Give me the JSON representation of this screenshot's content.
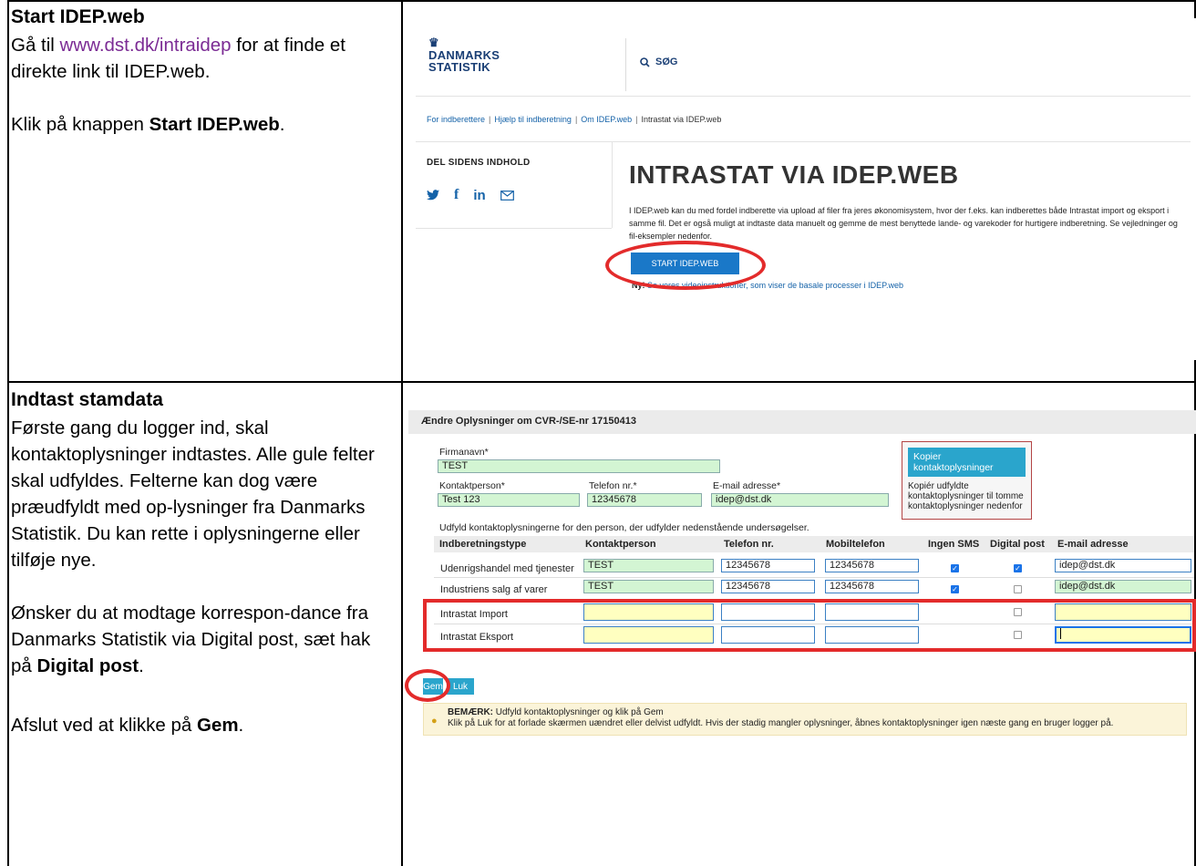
{
  "row1": {
    "heading": "Start IDEP.web",
    "p1_before": "Gå til ",
    "p1_link": "www.dst.dk/intraidep",
    "p1_after": " for at finde et direkte link til IDEP.web.",
    "p2_before": "Klik på knappen ",
    "p2_bold": "Start IDEP.web",
    "p2_after": "."
  },
  "row2": {
    "heading": "Indtast stamdata",
    "p1": "Første gang du logger ind, skal kontaktoplysninger indtastes. Alle gule felter skal udfyldes. Felterne kan dog være præudfyldt med op-lysninger fra Danmarks Statistik. Du kan rette i oplysningerne eller tilføje nye.",
    "p2_before": "Ønsker du at modtage korrespon-dance fra Danmarks Statistik via Digital post, sæt hak på ",
    "p2_bold": "Digital post",
    "p2_after": ".",
    "p3_before": "Afslut ved at klikke på ",
    "p3_bold": "Gem",
    "p3_after": "."
  },
  "site": {
    "logo_line1": "DANMARKS",
    "logo_line2": "STATISTIK",
    "search_label": "SØG",
    "breadcrumb": [
      "For indberettere",
      "Hjælp til indberetning",
      "Om IDEP.web",
      "Intrastat via IDEP.web"
    ],
    "share_title": "DEL SIDENS INDHOLD",
    "page_title": "INTRASTAT VIA IDEP.WEB",
    "intro": "I IDEP.web kan du med fordel indberette via upload af filer fra jeres økonomisystem, hvor der f.eks. kan indberettes både Intrastat import og eksport i samme fil. Det er også muligt at indtaste data manuelt og gemme de mest benyttede lande- og varekoder for hurtigere indberetning. Se vejledninger og fil-eksempler nedenfor.",
    "start_button": "START IDEP.WEB",
    "ny_bold": "Ny!",
    "ny_text": " Se vores videoinstruktioner, som viser de basale processer i IDEP.web"
  },
  "form": {
    "header": "Ændre Oplysninger om CVR-/SE-nr 17150413",
    "firmanavn_label": "Firmanavn*",
    "firmanavn_value": "TEST",
    "kontaktperson_label": "Kontaktperson*",
    "kontaktperson_value": "Test 123",
    "telefon_label": "Telefon nr.*",
    "telefon_value": "12345678",
    "email_label": "E-mail adresse*",
    "email_value": "idep@dst.dk",
    "copy_button": "Kopier kontaktoplysninger",
    "copy_desc": "Kopiér udfyldte kontaktoplysninger til tomme kontaktoplysninger nedenfor",
    "udfyld_text": "Udfyld kontaktoplysningerne for den person, der udfylder nedenstående undersøgelser.",
    "columns": [
      "Indberetningstype",
      "Kontaktperson",
      "Telefon nr.",
      "Mobiltelefon",
      "Ingen SMS",
      "Digital post",
      "E-mail adresse"
    ],
    "rows": [
      {
        "type": "Udenrigshandel med tjenester",
        "kontakt": "TEST",
        "telefon": "12345678",
        "mobil": "12345678",
        "ingen_sms": true,
        "digital_post": true,
        "email": "idep@dst.dk"
      },
      {
        "type": "Industriens salg af varer",
        "kontakt": "TEST",
        "telefon": "12345678",
        "mobil": "12345678",
        "ingen_sms": true,
        "digital_post": false,
        "email": "idep@dst.dk"
      },
      {
        "type": "Intrastat Import",
        "kontakt": "",
        "telefon": "",
        "mobil": "",
        "ingen_sms": null,
        "digital_post": false,
        "email": ""
      },
      {
        "type": "Intrastat Eksport",
        "kontakt": "",
        "telefon": "",
        "mobil": "",
        "ingen_sms": null,
        "digital_post": false,
        "email": ""
      }
    ],
    "gem_button": "Gem",
    "luk_button": "Luk",
    "note_bold": "BEMÆRK:",
    "note_line1": " Udfyld kontaktoplysninger og klik på Gem",
    "note_line2": "Klik på Luk for at forlade skærmen uændret eller delvist udfyldt. Hvis der stadig mangler oplysninger, åbnes kontaktoplysninger igen næste gang en bruger logger på."
  },
  "colors": {
    "highlight": "#e32b2b",
    "dst_blue": "#1a3f75",
    "button_blue": "#1a78c8",
    "field_green": "#d3f5d3",
    "field_yellow": "#ffffc0"
  }
}
